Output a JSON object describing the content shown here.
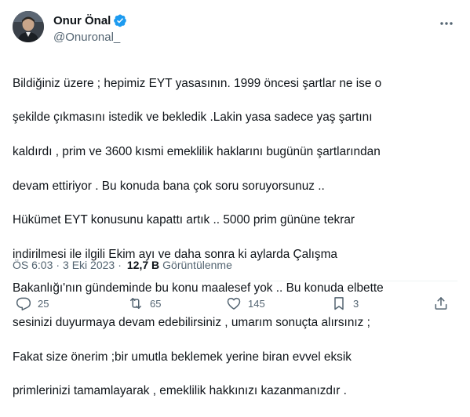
{
  "author": {
    "display_name": "Onur Önal",
    "handle": "@Onuronal_",
    "verified": true
  },
  "tweet": {
    "text_lines": [
      "Bildiğiniz üzere ; hepimiz EYT yasasının. 1999 öncesi şartlar ne ise o",
      "şekilde çıkmasını istedik ve bekledik .Lakin yasa sadece yaş şartını",
      "kaldırdı , prim ve 3600 kısmi emeklilik haklarını bugünün şartlarından",
      "devam ettiriyor . Bu konuda bana çok soru soruyorsunuz ..",
      "Hükümet EYT konusunu kapattı artık .. 5000 prim gününe tekrar",
      "indirilmesi ile  ilgili Ekim ayı ve daha sonra ki aylarda Çalışma",
      "Bakanlığı'nın gündeminde bu konu maalesef yok .. Bu konuda elbette",
      "sesinizi duyurmaya devam edebilirsiniz , umarım sonuçta alırsınız ;",
      "Fakat size önerim ;bir umutla beklemek yerine biran evvel eksik",
      "primlerinizi tamamlayarak , emeklilik hakkınızı kazanmanızdır ."
    ],
    "time": "ÖS 6:03",
    "separator": "·",
    "date": "3 Eki 2023",
    "views_count": "12,7 B",
    "views_label": "Görüntülenme"
  },
  "actions": {
    "replies": "25",
    "reposts": "65",
    "likes": "145",
    "bookmarks": "3"
  },
  "icons": {
    "more": "more-icon",
    "verified": "verified-badge-icon",
    "reply": "reply-icon",
    "repost": "repost-icon",
    "like": "like-icon",
    "bookmark": "bookmark-icon",
    "share": "share-icon"
  },
  "colors": {
    "verified_blue": "#1d9bf0",
    "text_primary": "#0f1419",
    "text_secondary": "#536471"
  }
}
